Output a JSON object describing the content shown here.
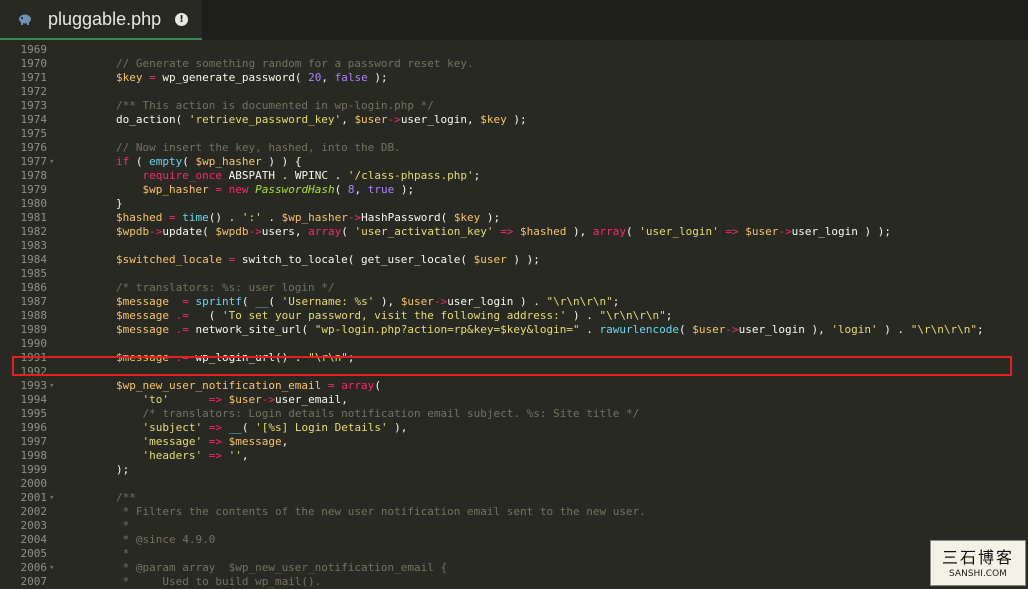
{
  "tab": {
    "title": "pluggable.php",
    "file_icon": "php-elephant-icon",
    "info_icon": "info-icon"
  },
  "watermark": {
    "title": "三石博客",
    "subtitle": "SANSHI.COM"
  },
  "colors": {
    "background": "#282923",
    "highlight_box": "#e3201b",
    "comment": "#75715e",
    "variable": "#f8c46c",
    "string": "#e6db74",
    "keyword": "#f92672",
    "number": "#ae81ff"
  },
  "code_lines": [
    {
      "n": "1969",
      "fold": false,
      "indent": "",
      "tokens": []
    },
    {
      "n": "1970",
      "fold": false,
      "indent": "",
      "tokens": [
        [
          "com",
          "// Generate something random for a password reset key."
        ]
      ]
    },
    {
      "n": "1971",
      "fold": false,
      "indent": "",
      "tokens": [
        [
          "var",
          "$key"
        ],
        [
          "kw",
          " = "
        ],
        [
          "plain",
          "wp_generate_password( "
        ],
        [
          "num",
          "20"
        ],
        [
          "plain",
          ", "
        ],
        [
          "num",
          "false"
        ],
        [
          "plain",
          " );"
        ]
      ]
    },
    {
      "n": "1972",
      "fold": false,
      "indent": "",
      "tokens": []
    },
    {
      "n": "1973",
      "fold": false,
      "indent": "",
      "tokens": [
        [
          "com",
          "/** This action is documented in wp-login.php */"
        ]
      ]
    },
    {
      "n": "1974",
      "fold": false,
      "indent": "",
      "tokens": [
        [
          "plain",
          "do_action( "
        ],
        [
          "str",
          "'retrieve_password_key'"
        ],
        [
          "plain",
          ", "
        ],
        [
          "var",
          "$user"
        ],
        [
          "kw",
          "->"
        ],
        [
          "plain",
          "user_login, "
        ],
        [
          "var",
          "$key"
        ],
        [
          "plain",
          " );"
        ]
      ]
    },
    {
      "n": "1975",
      "fold": false,
      "indent": "",
      "tokens": []
    },
    {
      "n": "1976",
      "fold": false,
      "indent": "",
      "tokens": [
        [
          "com",
          "// Now insert the key, hashed, into the DB."
        ]
      ]
    },
    {
      "n": "1977",
      "fold": true,
      "indent": "",
      "tokens": [
        [
          "kw",
          "if"
        ],
        [
          "plain",
          " ( "
        ],
        [
          "fn",
          "empty"
        ],
        [
          "plain",
          "( "
        ],
        [
          "var",
          "$wp_hasher"
        ],
        [
          "plain",
          " ) ) {"
        ]
      ]
    },
    {
      "n": "1978",
      "fold": false,
      "indent": "    ",
      "tokens": [
        [
          "kw",
          "require_once"
        ],
        [
          "plain",
          " ABSPATH . WPINC . "
        ],
        [
          "str",
          "'/class-phpass.php'"
        ],
        [
          "plain",
          ";"
        ]
      ]
    },
    {
      "n": "1979",
      "fold": false,
      "indent": "    ",
      "tokens": [
        [
          "var",
          "$wp_hasher"
        ],
        [
          "kw",
          " = "
        ],
        [
          "kw",
          "new "
        ],
        [
          "cls",
          "PasswordHash"
        ],
        [
          "plain",
          "( "
        ],
        [
          "num",
          "8"
        ],
        [
          "plain",
          ", "
        ],
        [
          "num",
          "true"
        ],
        [
          "plain",
          " );"
        ]
      ]
    },
    {
      "n": "1980",
      "fold": false,
      "indent": "",
      "tokens": [
        [
          "plain",
          "}"
        ]
      ]
    },
    {
      "n": "1981",
      "fold": false,
      "indent": "",
      "tokens": [
        [
          "var",
          "$hashed"
        ],
        [
          "kw",
          " = "
        ],
        [
          "fn",
          "time"
        ],
        [
          "plain",
          "() . "
        ],
        [
          "str",
          "':'"
        ],
        [
          "plain",
          " . "
        ],
        [
          "var",
          "$wp_hasher"
        ],
        [
          "kw",
          "->"
        ],
        [
          "plain",
          "HashPassword( "
        ],
        [
          "var",
          "$key"
        ],
        [
          "plain",
          " );"
        ]
      ]
    },
    {
      "n": "1982",
      "fold": false,
      "indent": "",
      "tokens": [
        [
          "var",
          "$wpdb"
        ],
        [
          "kw",
          "->"
        ],
        [
          "plain",
          "update( "
        ],
        [
          "var",
          "$wpdb"
        ],
        [
          "kw",
          "->"
        ],
        [
          "plain",
          "users, "
        ],
        [
          "kw",
          "array"
        ],
        [
          "plain",
          "( "
        ],
        [
          "str",
          "'user_activation_key'"
        ],
        [
          "kw",
          " => "
        ],
        [
          "var",
          "$hashed"
        ],
        [
          "plain",
          " ), "
        ],
        [
          "kw",
          "array"
        ],
        [
          "plain",
          "( "
        ],
        [
          "str",
          "'user_login'"
        ],
        [
          "kw",
          " => "
        ],
        [
          "var",
          "$user"
        ],
        [
          "kw",
          "->"
        ],
        [
          "plain",
          "user_login ) );"
        ]
      ]
    },
    {
      "n": "1983",
      "fold": false,
      "indent": "",
      "tokens": []
    },
    {
      "n": "1984",
      "fold": false,
      "indent": "",
      "tokens": [
        [
          "var",
          "$switched_locale"
        ],
        [
          "kw",
          " = "
        ],
        [
          "plain",
          "switch_to_locale( get_user_locale( "
        ],
        [
          "var",
          "$user"
        ],
        [
          "plain",
          " ) );"
        ]
      ]
    },
    {
      "n": "1985",
      "fold": false,
      "indent": "",
      "tokens": []
    },
    {
      "n": "1986",
      "fold": false,
      "indent": "",
      "tokens": [
        [
          "com",
          "/* translators: %s: user login */"
        ]
      ]
    },
    {
      "n": "1987",
      "fold": false,
      "indent": "",
      "tokens": [
        [
          "var",
          "$message"
        ],
        [
          "kw",
          "  = "
        ],
        [
          "fn",
          "sprintf"
        ],
        [
          "plain",
          "( "
        ],
        [
          "fn",
          "__"
        ],
        [
          "plain",
          "( "
        ],
        [
          "str",
          "'Username: %s'"
        ],
        [
          "plain",
          " ), "
        ],
        [
          "var",
          "$user"
        ],
        [
          "kw",
          "->"
        ],
        [
          "plain",
          "user_login ) . "
        ],
        [
          "str",
          "\"\\r\\n\\r\\n\""
        ],
        [
          "plain",
          ";"
        ]
      ]
    },
    {
      "n": "1988",
      "fold": false,
      "indent": "",
      "tokens": [
        [
          "var",
          "$message"
        ],
        [
          "kw",
          " .= "
        ],
        [
          "plain",
          "  ( "
        ],
        [
          "str",
          "'To set your password, visit the following address:'"
        ],
        [
          "plain",
          " ) . "
        ],
        [
          "str",
          "\"\\r\\n\\r\\n\""
        ],
        [
          "plain",
          ";"
        ]
      ]
    },
    {
      "n": "1989",
      "fold": false,
      "indent": "",
      "tokens": [
        [
          "var",
          "$message"
        ],
        [
          "kw",
          " .= "
        ],
        [
          "plain",
          "network_site_url( "
        ],
        [
          "str",
          "\"wp-login.php?action=rp&key=$key&login=\""
        ],
        [
          "plain",
          " . "
        ],
        [
          "fn",
          "rawurlencode"
        ],
        [
          "plain",
          "( "
        ],
        [
          "var",
          "$user"
        ],
        [
          "kw",
          "->"
        ],
        [
          "plain",
          "user_login ), "
        ],
        [
          "str",
          "'login'"
        ],
        [
          "plain",
          " ) . "
        ],
        [
          "str",
          "\"\\r\\n\\r\\n\""
        ],
        [
          "plain",
          ";"
        ]
      ]
    },
    {
      "n": "1990",
      "fold": false,
      "indent": "",
      "tokens": []
    },
    {
      "n": "1991",
      "fold": false,
      "indent": "",
      "tokens": [
        [
          "var",
          "$message"
        ],
        [
          "kw",
          " .= "
        ],
        [
          "plain",
          "wp_login_url() . "
        ],
        [
          "str",
          "\"\\r\\n\""
        ],
        [
          "plain",
          ";"
        ]
      ]
    },
    {
      "n": "1992",
      "fold": false,
      "indent": "",
      "tokens": []
    },
    {
      "n": "1993",
      "fold": true,
      "indent": "",
      "tokens": [
        [
          "var",
          "$wp_new_user_notification_email"
        ],
        [
          "kw",
          " = "
        ],
        [
          "kw",
          "array"
        ],
        [
          "plain",
          "("
        ]
      ]
    },
    {
      "n": "1994",
      "fold": false,
      "indent": "    ",
      "tokens": [
        [
          "str",
          "'to'"
        ],
        [
          "kw",
          "      => "
        ],
        [
          "var",
          "$user"
        ],
        [
          "kw",
          "->"
        ],
        [
          "plain",
          "user_email,"
        ]
      ]
    },
    {
      "n": "1995",
      "fold": false,
      "indent": "    ",
      "tokens": [
        [
          "com",
          "/* translators: Login details notification email subject. %s: Site title */"
        ]
      ]
    },
    {
      "n": "1996",
      "fold": false,
      "indent": "    ",
      "tokens": [
        [
          "str",
          "'subject'"
        ],
        [
          "kw",
          " => "
        ],
        [
          "fn",
          "__"
        ],
        [
          "plain",
          "( "
        ],
        [
          "str",
          "'[%s] Login Details'"
        ],
        [
          "plain",
          " ),"
        ]
      ]
    },
    {
      "n": "1997",
      "fold": false,
      "indent": "    ",
      "tokens": [
        [
          "str",
          "'message'"
        ],
        [
          "kw",
          " => "
        ],
        [
          "var",
          "$message"
        ],
        [
          "plain",
          ","
        ]
      ]
    },
    {
      "n": "1998",
      "fold": false,
      "indent": "    ",
      "tokens": [
        [
          "str",
          "'headers'"
        ],
        [
          "kw",
          " => "
        ],
        [
          "str",
          "''"
        ],
        [
          "plain",
          ","
        ]
      ]
    },
    {
      "n": "1999",
      "fold": false,
      "indent": "",
      "tokens": [
        [
          "plain",
          ");"
        ]
      ]
    },
    {
      "n": "2000",
      "fold": false,
      "indent": "",
      "tokens": []
    },
    {
      "n": "2001",
      "fold": true,
      "indent": "",
      "tokens": [
        [
          "com",
          "/**"
        ]
      ]
    },
    {
      "n": "2002",
      "fold": false,
      "indent": "",
      "tokens": [
        [
          "com",
          " * Filters the contents of the new user notification email sent to the new user."
        ]
      ]
    },
    {
      "n": "2003",
      "fold": false,
      "indent": "",
      "tokens": [
        [
          "com",
          " *"
        ]
      ]
    },
    {
      "n": "2004",
      "fold": false,
      "indent": "",
      "tokens": [
        [
          "com",
          " * @since 4.9.0"
        ]
      ]
    },
    {
      "n": "2005",
      "fold": false,
      "indent": "",
      "tokens": [
        [
          "com",
          " *"
        ]
      ]
    },
    {
      "n": "2006",
      "fold": true,
      "indent": "",
      "tokens": [
        [
          "com",
          " * @param array  $wp_new_user_notification_email {"
        ]
      ]
    },
    {
      "n": "2007",
      "fold": false,
      "indent": "",
      "tokens": [
        [
          "com",
          " *     Used to build wp_mail()."
        ]
      ]
    }
  ]
}
